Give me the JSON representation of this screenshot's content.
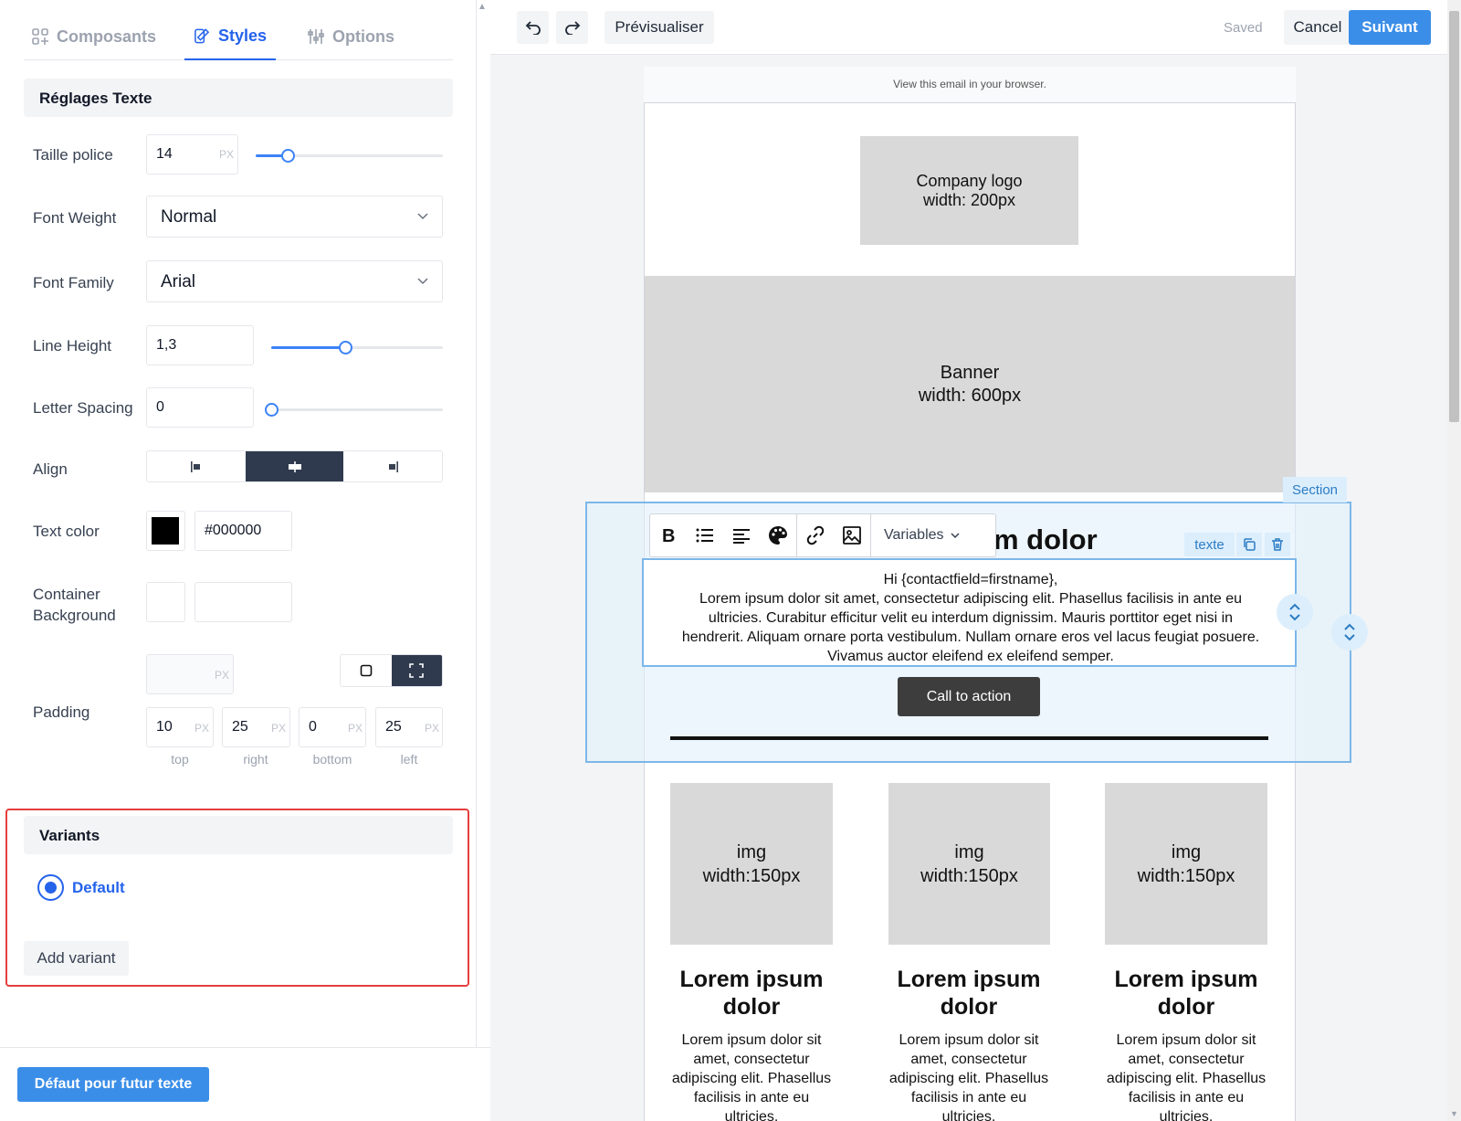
{
  "tabs": {
    "components": "Composants",
    "styles": "Styles",
    "options": "Options"
  },
  "text_settings": {
    "title": "Réglages Texte",
    "font_size_label": "Taille police",
    "font_size_value": "14",
    "font_size_unit": "PX",
    "font_size_slider_fraction": 0.17,
    "font_weight_label": "Font Weight",
    "font_weight_value": "Normal",
    "font_family_label": "Font Family",
    "font_family_value": "Arial",
    "line_height_label": "Line Height",
    "line_height_value": "1,3",
    "line_height_slider_fraction": 0.43,
    "letter_spacing_label": "Letter Spacing",
    "letter_spacing_value": "0",
    "letter_spacing_slider_fraction": 0.0,
    "align_label": "Align",
    "align_selected": "center",
    "text_color_label": "Text color",
    "text_color_value": "#000000",
    "container_bg_label_1": "Container",
    "container_bg_label_2": "Background",
    "container_bg_value": "",
    "padding_label": "Padding",
    "padding_all_unit": "PX",
    "padding_mode_selected": "individual",
    "padding_top": "10",
    "padding_right": "25",
    "padding_bottom": "0",
    "padding_left": "25",
    "padding_unit": "PX",
    "padding_top_label": "top",
    "padding_right_label": "right",
    "padding_bottom_label": "bottom",
    "padding_left_label": "left"
  },
  "variants": {
    "title": "Variants",
    "default_label": "Default",
    "add_label": "Add variant"
  },
  "footer": {
    "default_button": "Défaut pour futur texte"
  },
  "topbar": {
    "preview": "Prévisualiser",
    "saved": "Saved",
    "cancel": "Cancel",
    "next": "Suivant"
  },
  "email": {
    "view_in_browser": "View this email in your browser.",
    "logo_line1": "Company logo",
    "logo_line2": "width: 200px",
    "banner_line1": "Banner",
    "banner_line2": "width: 600px",
    "section_tag": "Section",
    "texte_tag": "texte",
    "heading_visible": "m dolor",
    "variables_label": "Variables",
    "greeting": "Hi {contactfield=firstname},",
    "body_text": "Lorem ipsum dolor sit amet, consectetur adipiscing elit. Phasellus facilisis in ante eu ultricies. Curabitur efficitur velit eu interdum dignissim. Mauris porttitor eget nisi in hendrerit. Aliquam ornare porta vestibulum. Nullam ornare eros vel lacus feugiat posuere. Vivamus auctor eleifend ex eleifend semper.",
    "cta": "Call to action",
    "columns": [
      {
        "img1": "img",
        "img2": "width:150px",
        "title": "Lorem ipsum dolor",
        "text": "Lorem ipsum dolor sit amet, consectetur adipiscing elit. Phasellus facilisis in ante eu ultricies."
      },
      {
        "img1": "img",
        "img2": "width:150px",
        "title": "Lorem ipsum dolor",
        "text": "Lorem ipsum dolor sit amet, consectetur adipiscing elit. Phasellus facilisis in ante eu ultricies."
      },
      {
        "img1": "img",
        "img2": "width:150px",
        "title": "Lorem ipsum dolor",
        "text": "Lorem ipsum dolor sit amet, consectetur adipiscing elit. Phasellus facilisis in ante eu ultricies."
      }
    ]
  },
  "colors": {
    "accent": "#2563eb",
    "primary_button": "#3b8ee8",
    "selection": "#7cb7e8",
    "cta_bg": "#3d3d3d",
    "highlight_border": "#e53e3e"
  }
}
